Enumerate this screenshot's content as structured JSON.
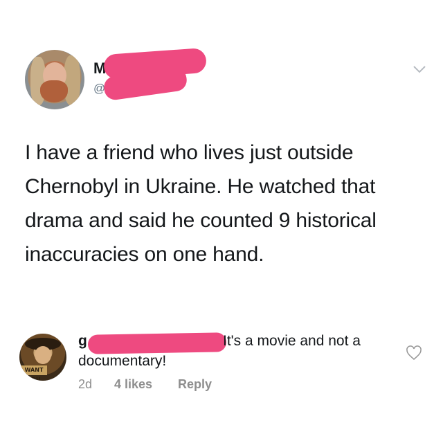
{
  "tweet": {
    "author_name": "M",
    "author_handle": "@",
    "text": "I have a friend who lives just outside Chernobyl in Ukraine. He watched that drama and said he counted 9 historical inaccuracies on one hand."
  },
  "reply": {
    "username": "g",
    "text_line1": "It's a movie and not a",
    "text_line2": "documentary!",
    "time": "2d",
    "likes": "4 likes",
    "reply_label": "Reply",
    "avatar_sign_text": "WANT YOU"
  },
  "icons": {
    "chevron": "chevron-down-icon",
    "heart": "heart-icon"
  },
  "colors": {
    "redaction": "#ee4a80",
    "meta_gray": "#8e8e8e",
    "handle_gray": "#657786"
  }
}
